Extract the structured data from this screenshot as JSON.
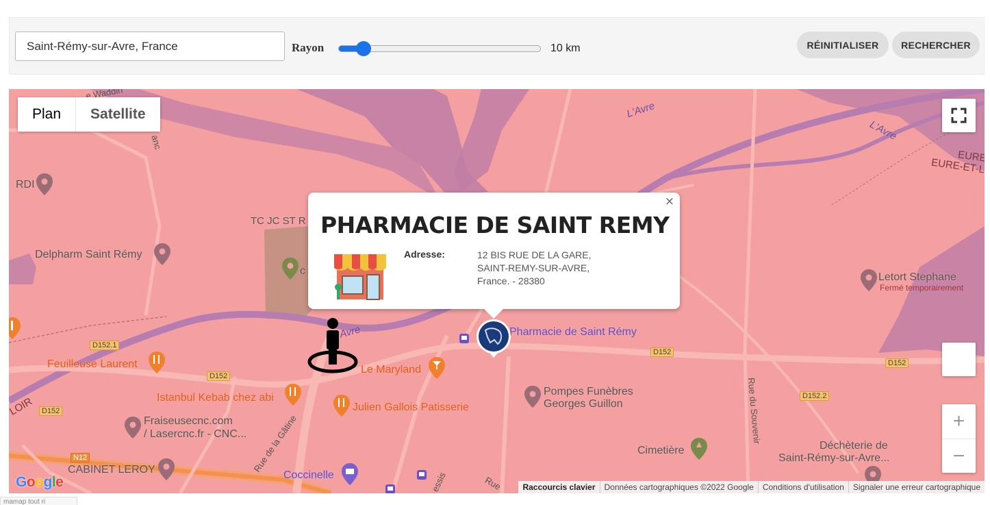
{
  "toolbar": {
    "address_value": "Saint-Rémy-sur-Avre, France",
    "radius_label": "Rayon",
    "radius_value": 10,
    "radius_display": "10 km",
    "reset_label": "RÉINITIALISER",
    "search_label": "RECHERCHER"
  },
  "map": {
    "map_type": {
      "plan": "Plan",
      "satellite": "Satellite",
      "selected": "Plan"
    },
    "labels": {
      "rdi": "RDI",
      "delpharm": "Delpharm Saint Rémy",
      "tc_jc": "TC JC ST R",
      "letort": "Letort Stephane",
      "letort_status": "Fermé temporairement",
      "feuilleuse": "Feuilleuse Laurent",
      "maryland": "Le Maryland",
      "istanbul": "Istanbul Kebab chez abi",
      "julien": "Julien Gallois Patisserie",
      "fraiseuse_1": "Fraiseusecnc.com",
      "fraiseuse_2": "/ Lasercnc.fr -  CNC...",
      "cabinet": "CABINET LEROY",
      "coccinelle": "Coccinelle",
      "pharmacie": "Pharmacie de Saint Rémy",
      "pompes_1": "Pompes Funèbres",
      "pompes_2": "Georges Guillon",
      "cimetiere": "Cimetière",
      "decheterie_1": "Déchèterie de",
      "decheterie_2": "Saint-Rémy-sur-Avre...",
      "avre_1": "L'Avre",
      "avre_2": "L'Avre",
      "avre_3": "Avre",
      "eure_1": "EURE",
      "eure_2": "EURE-ET-L",
      "loir": "LOIR",
      "wadding": "e Waddin",
      "anc": "anc",
      "rue_souvenir": "Rue du Souvenir",
      "rue_gatine": "Rue de la Gâtine",
      "essis": "essis",
      "rue_cut": "Rue",
      "c_cut": "c"
    },
    "road_shields": {
      "d152_1": "D152.1",
      "d152_a": "D152",
      "d152_b": "D152",
      "d152_c": "D152",
      "d152_d": "D152",
      "d152_2": "D152.2",
      "n12": "N12"
    },
    "attribution": {
      "shortcuts": "Raccourcis clavier",
      "data": "Données cartographiques ©2022 Google",
      "terms": "Conditions d'utilisation",
      "report": "Signaler une erreur cartographique"
    },
    "logo": [
      "G",
      "o",
      "o",
      "g",
      "l",
      "e"
    ],
    "zoom_in": "+",
    "zoom_out": "−",
    "colors": {
      "land": "#f4a0a1",
      "water": "#c17fa6",
      "road": "#f8b8b4",
      "accent": "#1a73e8",
      "marker_blue": "#1b3a7a"
    }
  },
  "infowindow": {
    "close": "×",
    "title": "PHARMACIE DE SAINT REMY",
    "address_label": "Adresse:",
    "address_lines": [
      "12 BIS RUE DE LA GARE,",
      "SAINT-REMY-SUR-AVRE,",
      "France. - 28380"
    ]
  },
  "bottom_tab": "mamap tout ri"
}
